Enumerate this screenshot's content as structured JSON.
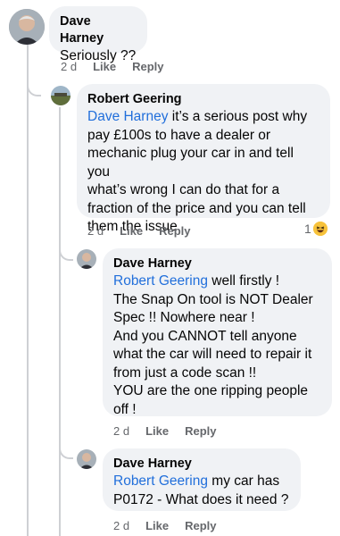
{
  "comments": [
    {
      "author": "Dave Harney",
      "text": "Seriously ??",
      "time": "2 d",
      "like": "Like",
      "reply": "Reply"
    },
    {
      "author": "Robert Geering",
      "mention": "Dave Harney",
      "text_line1_rest": " it’s a serious post why",
      "lines": [
        "pay £100s to have a dealer or",
        "mechanic plug your car in and tell you",
        "what’s wrong I can do that for a",
        "fraction of the price and you can tell",
        "them the issue"
      ],
      "time": "2 d",
      "like": "Like",
      "reply": "Reply",
      "reaction_count": "1",
      "reaction_icon": "haha-emoji-icon"
    },
    {
      "author": "Dave Harney",
      "mention": "Robert Geering",
      "text_line1_rest": " well firstly !",
      "lines": [
        "The Snap On tool is NOT Dealer",
        "Spec !! Nowhere near !",
        "And you CANNOT tell anyone",
        "what the car will need to repair it",
        "from just a code scan !!",
        "YOU are the one ripping people",
        "off !"
      ],
      "time": "2 d",
      "like": "Like",
      "reply": "Reply"
    },
    {
      "author": "Dave Harney",
      "mention": "Robert Geering",
      "text_line1_rest": " my car has",
      "lines": [
        "P0172 - What does it need ?"
      ],
      "time": "2 d",
      "like": "Like",
      "reply": "Reply"
    }
  ],
  "colors": {
    "bubble": "#f0f2f5",
    "mention": "#216fdb",
    "meta": "#65676b",
    "thread_line": "#ced0d4"
  }
}
